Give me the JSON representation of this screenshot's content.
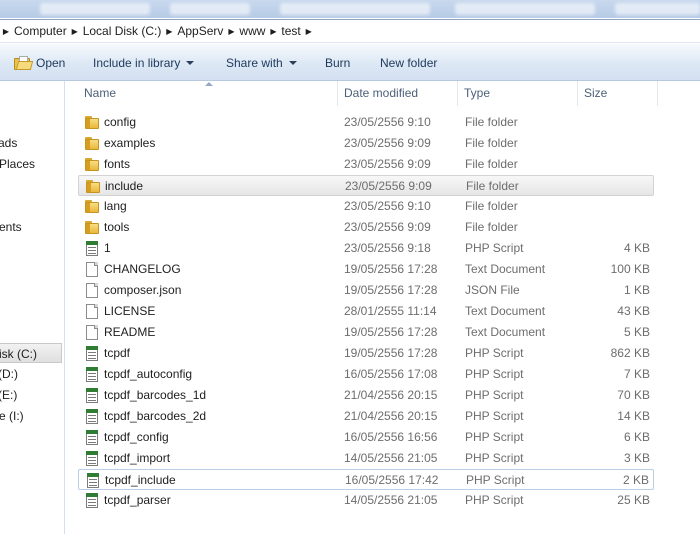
{
  "address": {
    "crumbs": [
      "Computer",
      "Local Disk (C:)",
      "AppServ",
      "www",
      "test"
    ]
  },
  "toolbar": {
    "open_label": "Open",
    "include_label": "Include in library",
    "share_label": "Share with",
    "burn_label": "Burn",
    "newfolder_label": "New folder"
  },
  "nav": {
    "items": [
      "ads",
      "Places",
      "ents",
      "isk (C:)",
      "(D:)",
      "(E:)",
      "e (I:)"
    ]
  },
  "columns": {
    "name": "Name",
    "date": "Date modified",
    "type": "Type",
    "size": "Size"
  },
  "files": [
    {
      "name": "config",
      "date": "23/05/2556 9:10",
      "type": "File folder",
      "size": "",
      "icon": "folder-icon"
    },
    {
      "name": "examples",
      "date": "23/05/2556 9:09",
      "type": "File folder",
      "size": "",
      "icon": "folder-icon"
    },
    {
      "name": "fonts",
      "date": "23/05/2556 9:09",
      "type": "File folder",
      "size": "",
      "icon": "folder-icon"
    },
    {
      "name": "include",
      "date": "23/05/2556 9:09",
      "type": "File folder",
      "size": "",
      "icon": "folder-icon"
    },
    {
      "name": "lang",
      "date": "23/05/2556 9:10",
      "type": "File folder",
      "size": "",
      "icon": "folder-icon"
    },
    {
      "name": "tools",
      "date": "23/05/2556 9:09",
      "type": "File folder",
      "size": "",
      "icon": "folder-icon"
    },
    {
      "name": "1",
      "date": "23/05/2556 9:18",
      "type": "PHP Script",
      "size": "4 KB",
      "icon": "php-icon"
    },
    {
      "name": "CHANGELOG",
      "date": "19/05/2556 17:28",
      "type": "Text Document",
      "size": "100 KB",
      "icon": "document-icon"
    },
    {
      "name": "composer.json",
      "date": "19/05/2556 17:28",
      "type": "JSON File",
      "size": "1 KB",
      "icon": "document-icon"
    },
    {
      "name": "LICENSE",
      "date": "28/01/2555 11:14",
      "type": "Text Document",
      "size": "43 KB",
      "icon": "document-icon"
    },
    {
      "name": "README",
      "date": "19/05/2556 17:28",
      "type": "Text Document",
      "size": "5 KB",
      "icon": "document-icon"
    },
    {
      "name": "tcpdf",
      "date": "19/05/2556 17:28",
      "type": "PHP Script",
      "size": "862 KB",
      "icon": "php-icon"
    },
    {
      "name": "tcpdf_autoconfig",
      "date": "16/05/2556 17:08",
      "type": "PHP Script",
      "size": "7 KB",
      "icon": "php-icon"
    },
    {
      "name": "tcpdf_barcodes_1d",
      "date": "21/04/2556 20:15",
      "type": "PHP Script",
      "size": "70 KB",
      "icon": "php-icon"
    },
    {
      "name": "tcpdf_barcodes_2d",
      "date": "21/04/2556 20:15",
      "type": "PHP Script",
      "size": "14 KB",
      "icon": "php-icon"
    },
    {
      "name": "tcpdf_config",
      "date": "16/05/2556 16:56",
      "type": "PHP Script",
      "size": "6 KB",
      "icon": "php-icon"
    },
    {
      "name": "tcpdf_import",
      "date": "14/05/2556 21:05",
      "type": "PHP Script",
      "size": "3 KB",
      "icon": "php-icon"
    },
    {
      "name": "tcpdf_include",
      "date": "16/05/2556 17:42",
      "type": "PHP Script",
      "size": "2 KB",
      "icon": "php-icon"
    },
    {
      "name": "tcpdf_parser",
      "date": "14/05/2556 21:05",
      "type": "PHP Script",
      "size": "25 KB",
      "icon": "php-icon"
    }
  ]
}
